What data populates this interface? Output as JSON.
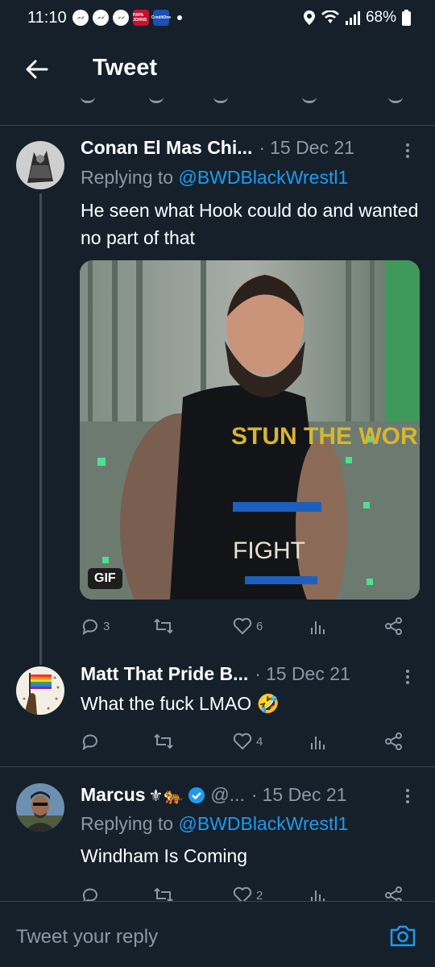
{
  "status_bar": {
    "time": "11:10",
    "battery": "68%",
    "papa_label": "PAPA JOHNS",
    "credit_label": "CreditOne"
  },
  "header": {
    "title": "Tweet"
  },
  "tweets": [
    {
      "name": "Conan El Mas Chi...",
      "date": "15 Dec 21",
      "replying_prefix": "Replying to ",
      "replying_handle": "@BWDBlackWrestl1",
      "text": "He seen what Hook could do and wanted no part of that",
      "gif_label": "GIF",
      "gif_shirt_text": "STUN THE WORLD",
      "gif_shirt_text2": "FIGHT",
      "reply_count": "3",
      "retweet_count": "",
      "like_count": "6"
    },
    {
      "name": "Matt That Pride B...",
      "date": "15 Dec 21",
      "text": "What the fuck LMAO 🤣",
      "reply_count": "",
      "retweet_count": "",
      "like_count": "4"
    },
    {
      "name": "Marcus",
      "name_emoji": "⚜🐅",
      "handle": "@...",
      "date": "15 Dec 21",
      "replying_prefix": "Replying to ",
      "replying_handle": "@BWDBlackWrestl1",
      "text": "Windham Is Coming",
      "reply_count": "",
      "retweet_count": "",
      "like_count": "2"
    }
  ],
  "reply_bar": {
    "placeholder": "Tweet your reply"
  },
  "colors": {
    "background": "#15202b",
    "accent": "#1d9bf0",
    "muted": "#8b98a5",
    "divider": "#38444d"
  }
}
